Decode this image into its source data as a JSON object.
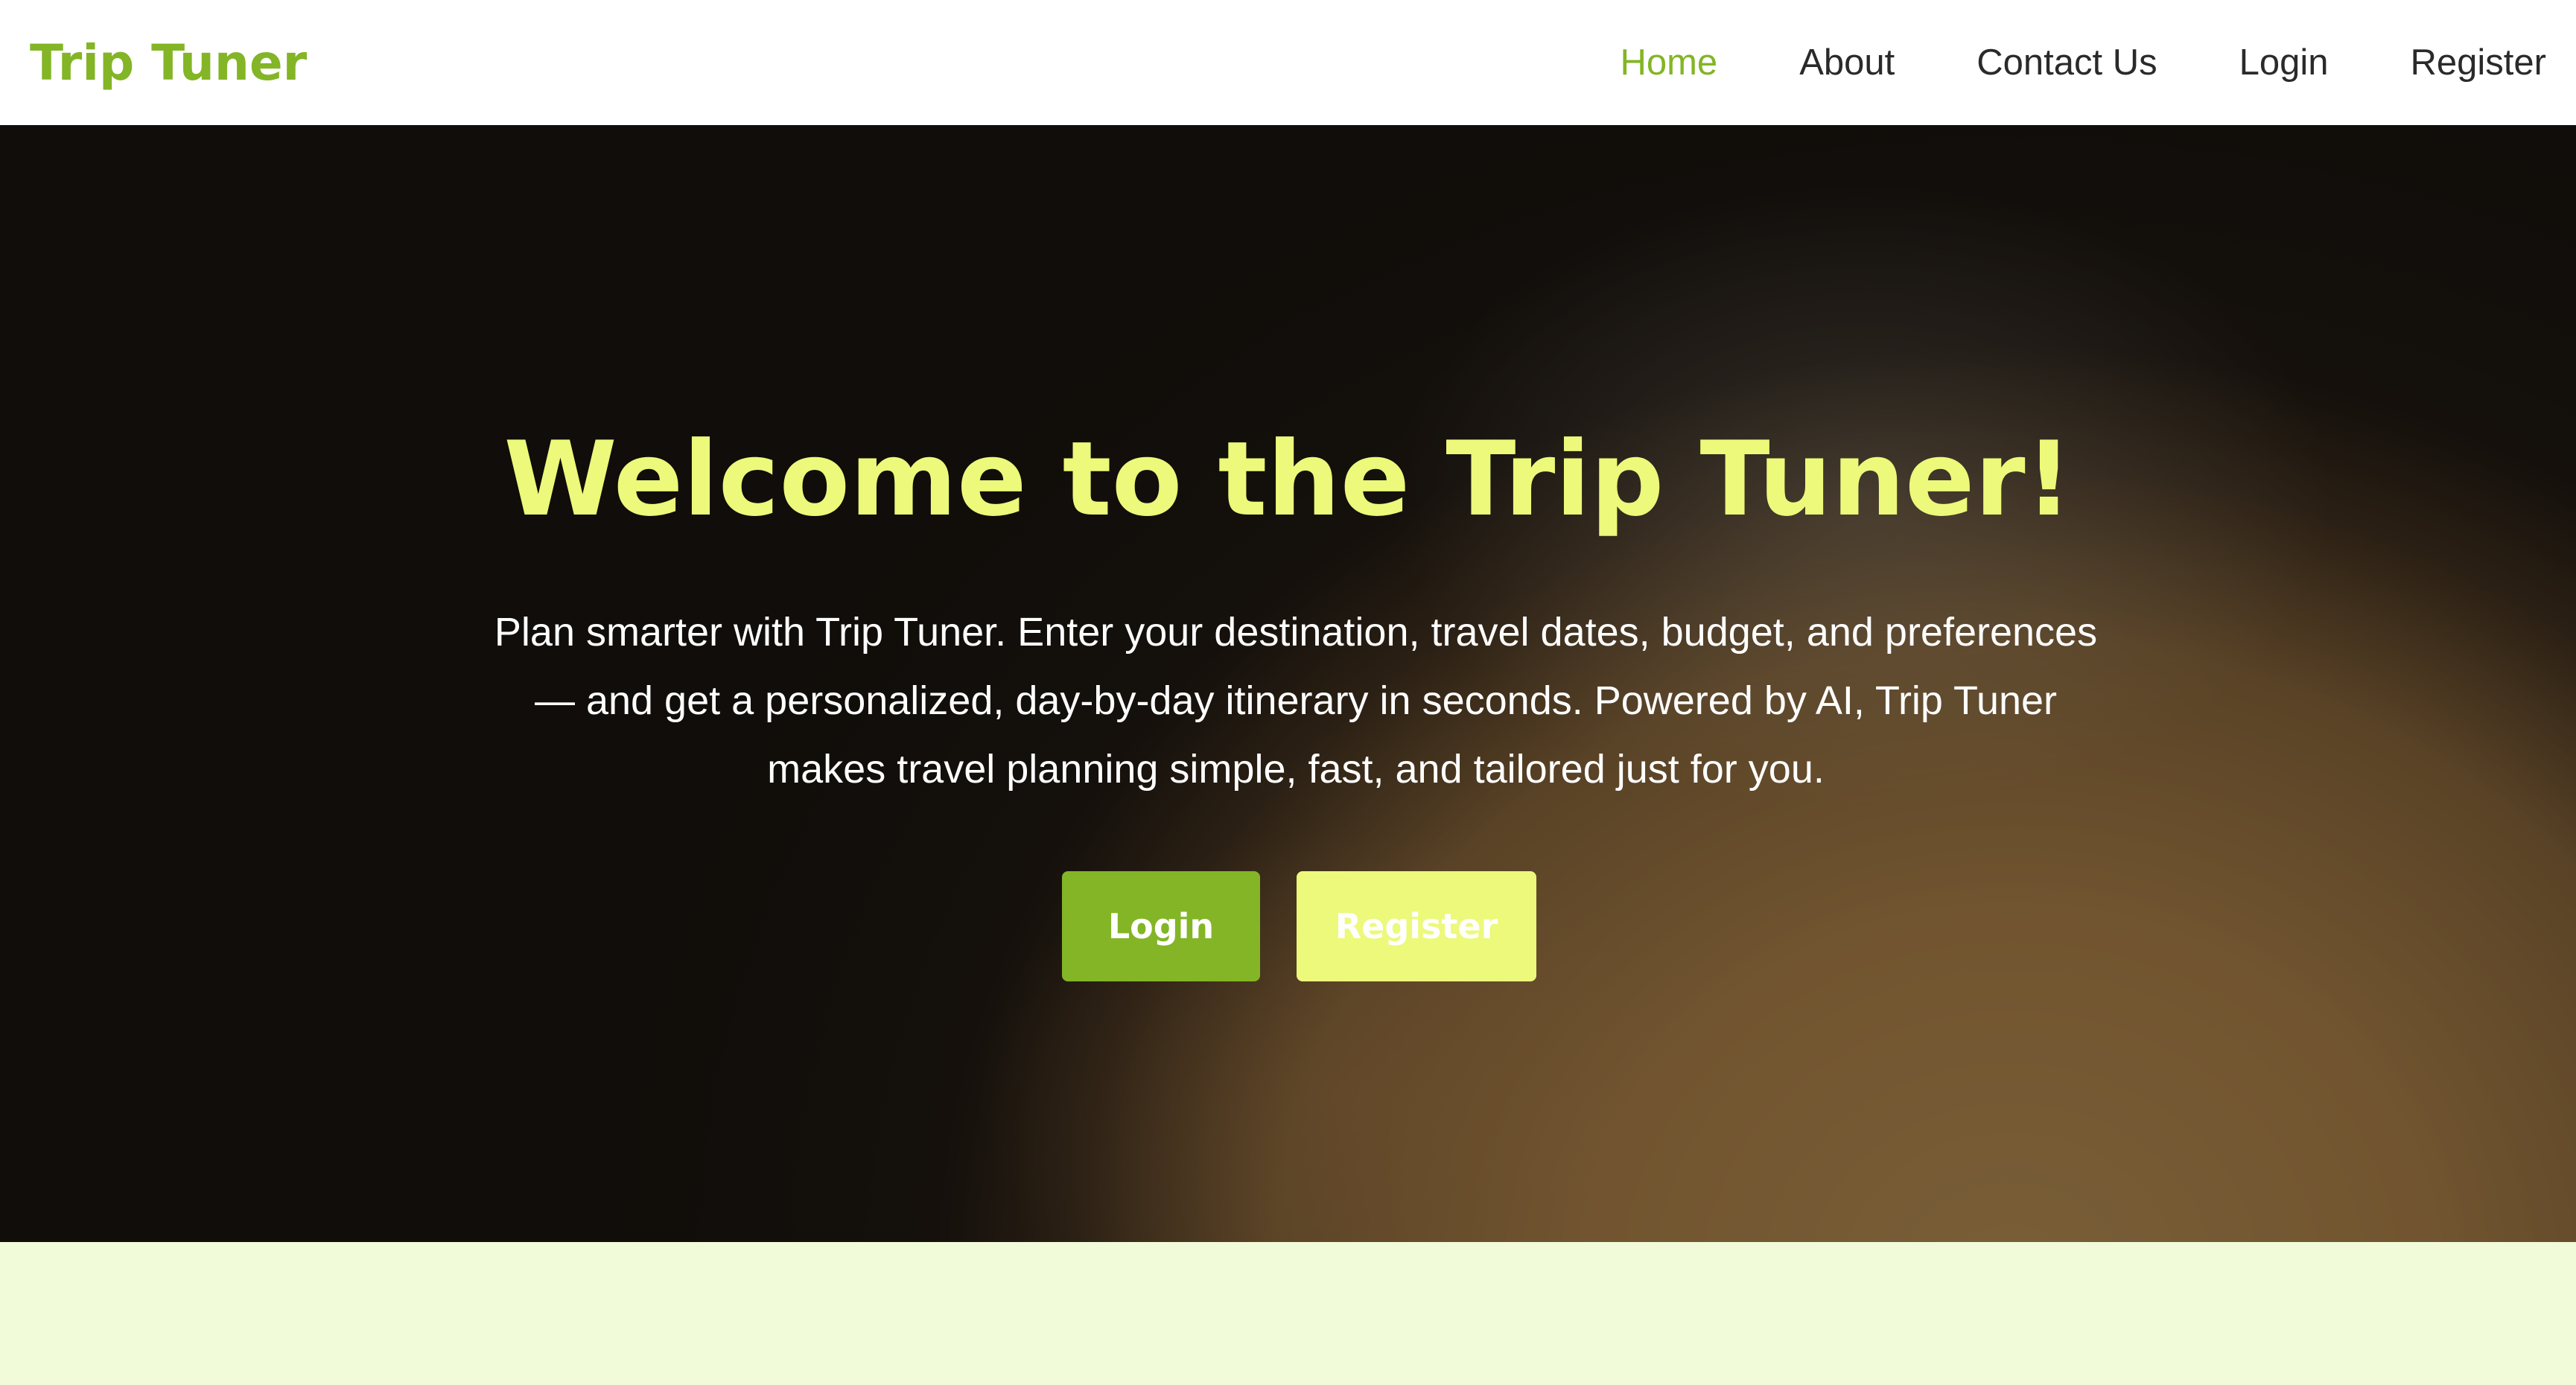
{
  "brand": {
    "name": "Trip Tuner"
  },
  "nav": {
    "items": [
      {
        "label": "Home",
        "active": true
      },
      {
        "label": "About",
        "active": false
      },
      {
        "label": "Contact Us",
        "active": false
      },
      {
        "label": "Login",
        "active": false
      },
      {
        "label": "Register",
        "active": false
      }
    ]
  },
  "hero": {
    "title": "Welcome to the Trip Tuner!",
    "description": "Plan smarter with Trip Tuner. Enter your destination, travel dates, budget, and preferences — and get a personalized, day-by-day itinerary in seconds. Powered by AI, Trip Tuner makes travel planning simple, fast, and tailored just for you.",
    "buttons": {
      "login_label": "Login",
      "register_label": "Register"
    },
    "background_image": "globe-photo"
  },
  "colors": {
    "accent_green": "#83b526",
    "accent_yellow": "#ecf97a",
    "page_background": "#f1fbd9",
    "nav_text": "#2a2a2a"
  }
}
